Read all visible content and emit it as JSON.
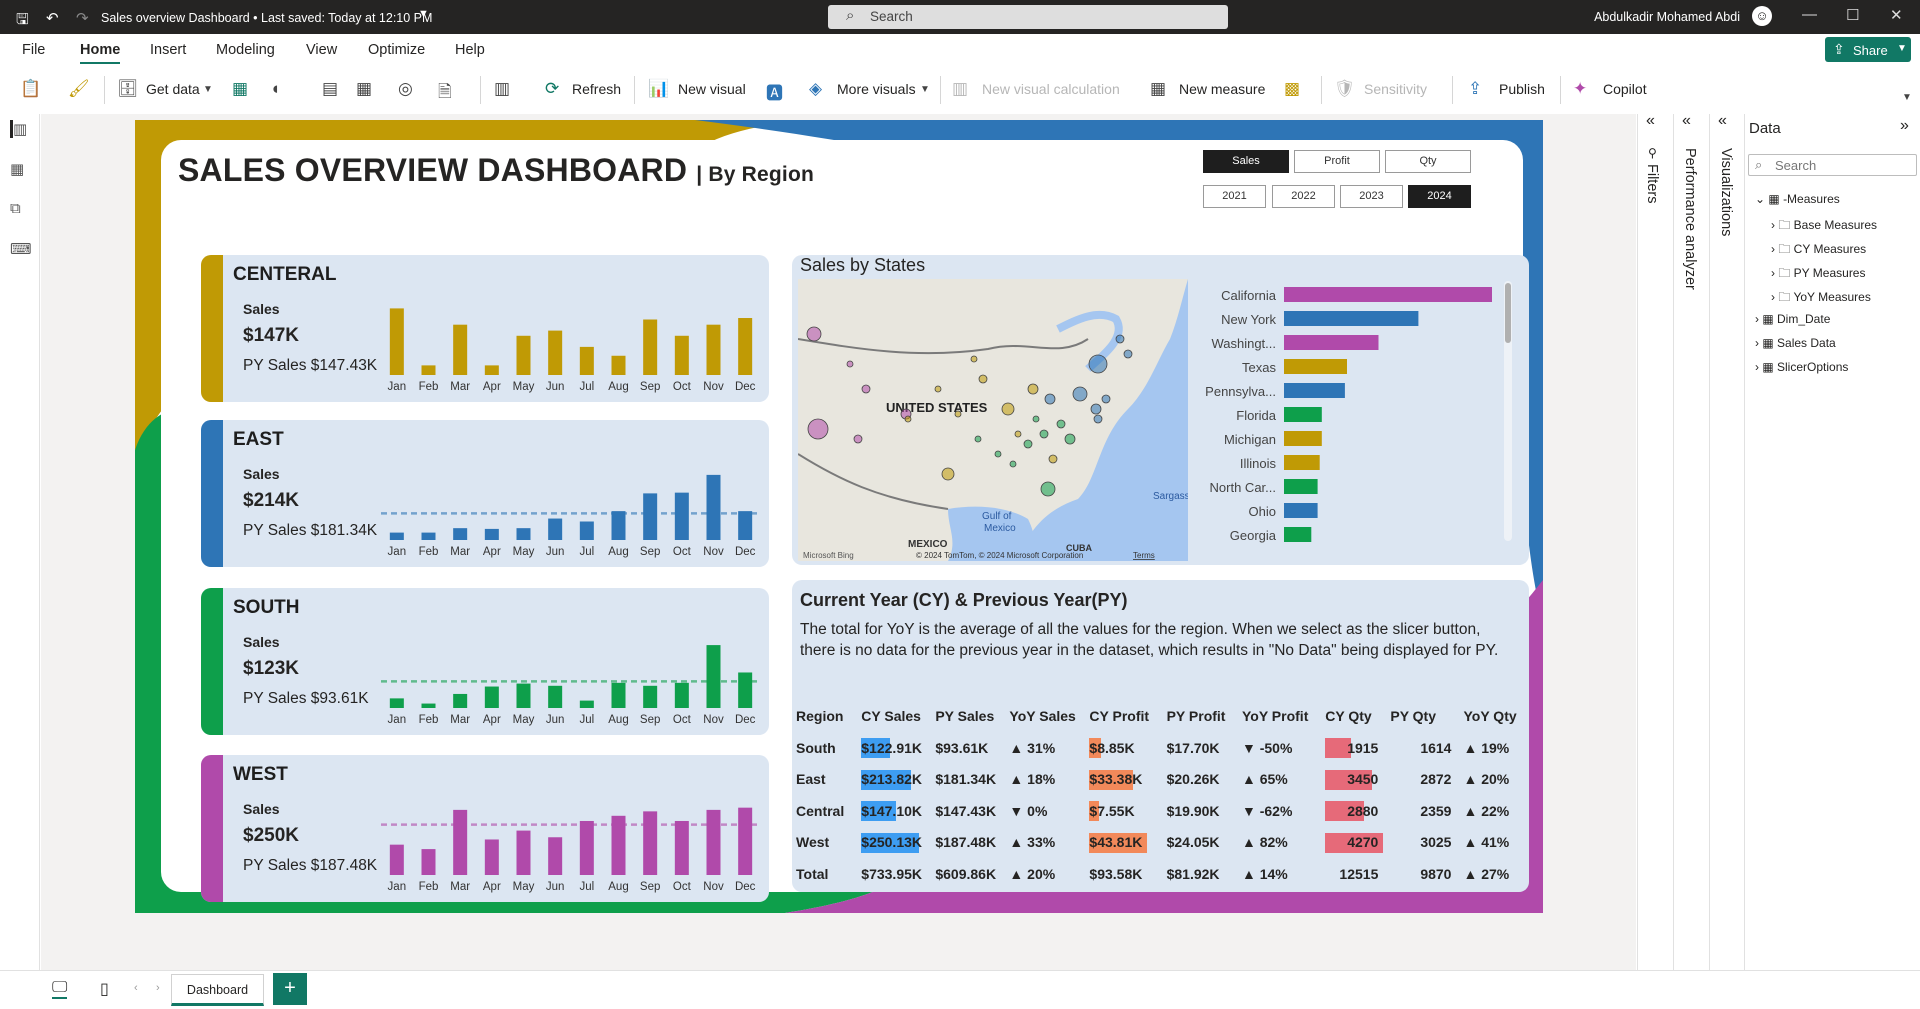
{
  "titlebar": {
    "doc_title": "Sales overview Dashboard • Last saved: Today at 12:10 PM",
    "search_placeholder": "Search",
    "user": "Abdulkadir Mohamed Abdi"
  },
  "menu": {
    "items": [
      "File",
      "Home",
      "Insert",
      "Modeling",
      "View",
      "Optimize",
      "Help"
    ],
    "share": "Share"
  },
  "ribbon": {
    "get_data": "Get data",
    "refresh": "Refresh",
    "new_visual": "New visual",
    "more_visuals": "More visuals",
    "new_visual_calc": "New visual calculation",
    "new_measure": "New measure",
    "sensitivity": "Sensitivity",
    "publish": "Publish",
    "copilot": "Copilot"
  },
  "report": {
    "title": "SALES OVERVIEW DASHBOARD",
    "subtitle": "| By Region",
    "metric_buttons": [
      "Sales",
      "Profit",
      "Qty"
    ],
    "selected_metric": "Sales",
    "year_buttons": [
      "2021",
      "2022",
      "2023",
      "2024"
    ],
    "selected_year": "2024",
    "months": [
      "Jan",
      "Feb",
      "Mar",
      "Apr",
      "May",
      "Jun",
      "Jul",
      "Aug",
      "Sep",
      "Oct",
      "Nov",
      "Dec"
    ],
    "regions": [
      {
        "name": "CENTERAL",
        "sales_label": "Sales",
        "sales": "$147K",
        "py": "PY Sales $147.43K",
        "color": "#c09a05",
        "values": [
          0.9,
          0.13,
          0.68,
          0.13,
          0.53,
          0.6,
          0.38,
          0.26,
          0.75,
          0.53,
          0.68,
          0.77
        ],
        "ref": null
      },
      {
        "name": "EAST",
        "sales_label": "Sales",
        "sales": "$214K",
        "py": "PY Sales $181.34K",
        "color": "#2e75b6",
        "values": [
          0.1,
          0.1,
          0.16,
          0.15,
          0.16,
          0.29,
          0.25,
          0.39,
          0.63,
          0.64,
          0.88,
          0.39
        ],
        "ref": 0.36
      },
      {
        "name": "SOUTH",
        "sales_label": "Sales",
        "sales": "$123K",
        "py": "PY Sales $93.61K",
        "color": "#0e9f4b",
        "values": [
          0.13,
          0.06,
          0.19,
          0.29,
          0.33,
          0.3,
          0.1,
          0.34,
          0.3,
          0.34,
          0.85,
          0.48
        ],
        "ref": 0.36
      },
      {
        "name": "WEST",
        "sales_label": "Sales",
        "sales": "$250K",
        "py": "PY Sales $187.48K",
        "color": "#b04aaa",
        "values": [
          0.41,
          0.35,
          0.88,
          0.48,
          0.6,
          0.51,
          0.73,
          0.8,
          0.86,
          0.73,
          0.88,
          0.91
        ],
        "ref": 0.68
      }
    ],
    "map": {
      "title": "Sales by States",
      "country_label": "UNITED STATES",
      "labels": [
        "Gulf of",
        "Mexico",
        "MEXICO",
        "CUBA",
        "Sargass"
      ],
      "copyright": "© 2024 TomTom, © 2024 Microsoft Corporation",
      "terms": "Terms",
      "bing": "Microsoft Bing"
    },
    "chart_data": {
      "type": "bar",
      "categories": [
        "California",
        "New York",
        "Washingt...",
        "Texas",
        "Pennsylva...",
        "Florida",
        "Michigan",
        "Illinois",
        "North Car...",
        "Ohio",
        "Georgia"
      ],
      "values": [
        100,
        64,
        45,
        30,
        29,
        18,
        18,
        17,
        16,
        16,
        13
      ],
      "colors": [
        "#b04aaa",
        "#2e75b6",
        "#b04aaa",
        "#c09a05",
        "#2e75b6",
        "#0e9f4b",
        "#c09a05",
        "#c09a05",
        "#0e9f4b",
        "#2e75b6",
        "#0e9f4b"
      ]
    },
    "table": {
      "title": "Current Year (CY) & Previous Year(PY)",
      "description": "The total for YoY is the average of all the values for the region. When we select as the slicer button, there is no data for the previous year in the dataset, which results in \"No Data\" being displayed for PY.",
      "headers": [
        "Region",
        "CY Sales",
        "PY Sales",
        "YoY Sales",
        "CY Profit",
        "PY Profit",
        "YoY Profit",
        "CY Qty",
        "PY Qty",
        "YoY Qty"
      ],
      "rows": [
        [
          "South",
          "$122.91K",
          "$93.61K",
          "▲ 31%",
          "$8.85K",
          "$17.70K",
          "▼ -50%",
          "1915",
          "1614",
          "▲ 19%"
        ],
        [
          "East",
          "$213.82K",
          "$181.34K",
          "▲ 18%",
          "$33.38K",
          "$20.26K",
          "▲ 65%",
          "3450",
          "2872",
          "▲ 20%"
        ],
        [
          "Central",
          "$147.10K",
          "$147.43K",
          "▼ 0%",
          "$7.55K",
          "$19.90K",
          "▼ -62%",
          "2880",
          "2359",
          "▲ 22%"
        ],
        [
          "West",
          "$250.13K",
          "$187.48K",
          "▲ 33%",
          "$43.81K",
          "$24.05K",
          "▲ 82%",
          "4270",
          "3025",
          "▲ 41%"
        ],
        [
          "Total",
          "$733.95K",
          "$609.86K",
          "▲ 20%",
          "$93.58K",
          "$81.92K",
          "▲ 14%",
          "12515",
          "9870",
          "▲ 27%"
        ]
      ],
      "cy_sales_fill": [
        0.49,
        0.85,
        0.59,
        1.0
      ],
      "cy_profit_fill": [
        0.2,
        0.76,
        0.17,
        1.0
      ],
      "cy_qty_fill": [
        0.45,
        0.81,
        0.67,
        1.0
      ]
    }
  },
  "panes": {
    "filters": "Filters",
    "performance": "Performance analyzer",
    "visualizations": "Visualizations",
    "data_title": "Data",
    "search": "Search",
    "tree": [
      "-Measures",
      "Base Measures",
      "CY Measures",
      "PY Measures",
      "YoY Measures",
      "Dim_Date",
      "Sales Data",
      "SlicerOptions"
    ]
  },
  "pages": {
    "tab": "Dashboard"
  }
}
